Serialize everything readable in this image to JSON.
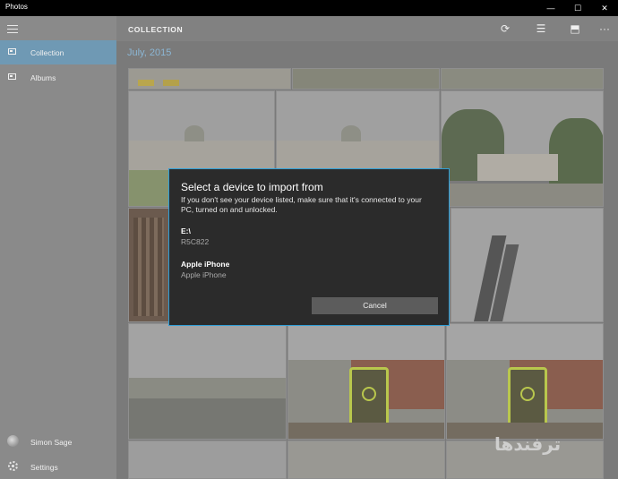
{
  "window": {
    "title": "Photos",
    "minimize_glyph": "—",
    "maximize_glyph": "☐",
    "close_glyph": "✕"
  },
  "sidebar": {
    "menu_icon": "hamburger-icon",
    "items": [
      {
        "label": "Collection",
        "icon": "photos-icon",
        "active": true
      },
      {
        "label": "Albums",
        "icon": "albums-icon",
        "active": false
      }
    ],
    "user": {
      "label": "Simon Sage",
      "icon": "avatar"
    },
    "settings": {
      "label": "Settings",
      "icon": "gear-icon"
    }
  },
  "toolbar": {
    "heading": "COLLECTION",
    "refresh_glyph": "⟳",
    "select_glyph": "☰",
    "import_glyph": "⬒",
    "more_glyph": "···"
  },
  "collection": {
    "date_header": "July, 2015"
  },
  "dialog": {
    "title": "Select a device to import from",
    "message": "If you don't see your device listed, make sure that it's connected to your PC, turned on and unlocked.",
    "devices": [
      {
        "name": "E:\\",
        "sub": "R5C822"
      },
      {
        "name": "Apple iPhone",
        "sub": "Apple iPhone"
      }
    ],
    "cancel_label": "Cancel"
  },
  "watermark": {
    "text": "ترفندها"
  },
  "colors": {
    "accent": "#6f99b4",
    "dialog_border": "#2f9fd8",
    "date_header": "#8bb6d4"
  }
}
